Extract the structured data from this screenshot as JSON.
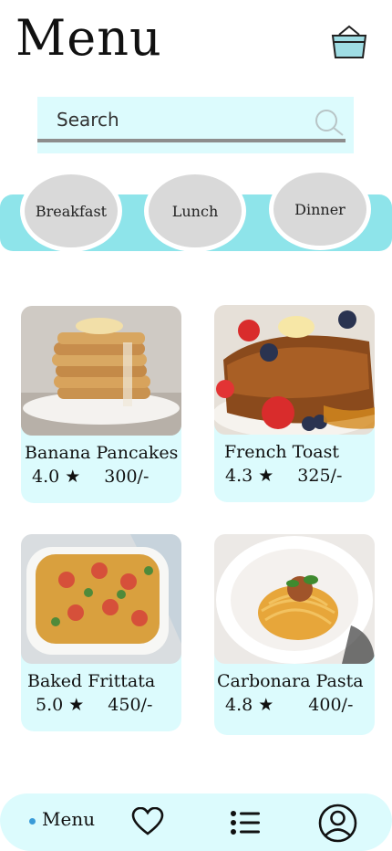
{
  "header": {
    "title": "Menu",
    "cart_icon": "basket-icon"
  },
  "search": {
    "placeholder": "Search",
    "icon": "search-icon"
  },
  "categories": [
    {
      "label": "Breakfast"
    },
    {
      "label": "Lunch"
    },
    {
      "label": "Dinner"
    }
  ],
  "items": [
    {
      "name": "Banana Pancakes",
      "rating": "4.0 ★",
      "price": "300/-"
    },
    {
      "name": "French Toast",
      "rating": "4.3 ★",
      "price": "325/-"
    },
    {
      "name": "Baked Frittata",
      "rating": "5.0 ★",
      "price": "450/-"
    },
    {
      "name": "Carbonara Pasta",
      "rating": "4.8 ★",
      "price": "400/-"
    }
  ],
  "nav": {
    "menu_label": "Menu",
    "icons": [
      "heart-icon",
      "list-icon",
      "profile-icon"
    ]
  },
  "colors": {
    "accent": "#8ee4ea",
    "panel": "#dcfbfd",
    "category_bubble": "#d9d9d9"
  }
}
